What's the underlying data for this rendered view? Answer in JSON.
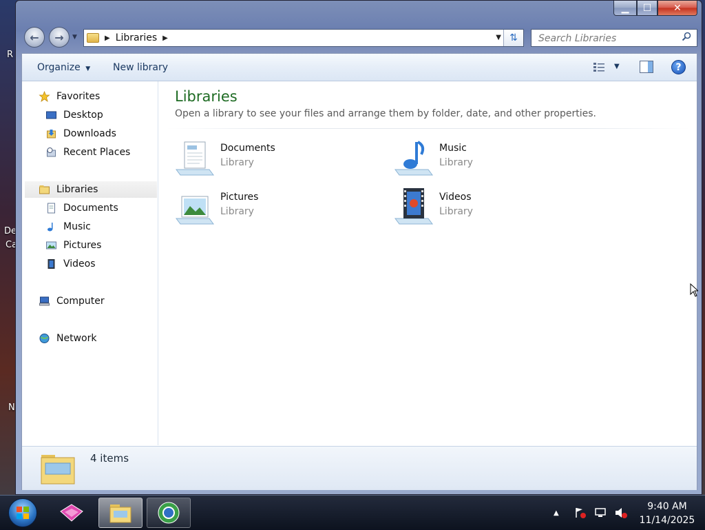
{
  "desktop": {
    "texts": [
      "R",
      "De",
      "Ca",
      "N"
    ]
  },
  "window": {
    "captions": {
      "minimize": "▁",
      "maximize": "☐",
      "close": "✕"
    },
    "address": {
      "crumb": "Libraries"
    },
    "search": {
      "placeholder": "Search Libraries"
    },
    "toolbar": {
      "organize": "Organize",
      "new_library": "New library"
    },
    "nav": {
      "favorites": "Favorites",
      "desktop": "Desktop",
      "downloads": "Downloads",
      "recent_places": "Recent Places",
      "libraries": "Libraries",
      "documents": "Documents",
      "music": "Music",
      "pictures": "Pictures",
      "videos": "Videos",
      "computer": "Computer",
      "network": "Network"
    },
    "content": {
      "title": "Libraries",
      "subtitle": "Open a library to see your files and arrange them by folder, date, and other properties.",
      "libraries": [
        {
          "name": "Documents",
          "type": "Library",
          "icon": "documents-library-icon"
        },
        {
          "name": "Music",
          "type": "Library",
          "icon": "music-library-icon"
        },
        {
          "name": "Pictures",
          "type": "Library",
          "icon": "pictures-library-icon"
        },
        {
          "name": "Videos",
          "type": "Library",
          "icon": "videos-library-icon"
        }
      ]
    },
    "status": {
      "count": "4 items"
    }
  },
  "taskbar": {
    "clock": {
      "time": "9:40 AM",
      "date": "11/14/2025"
    }
  },
  "colors": {
    "title_green": "#1e6b23",
    "toolbar_text": "#1c3a62",
    "library_type_gray": "#8a8a8a"
  }
}
